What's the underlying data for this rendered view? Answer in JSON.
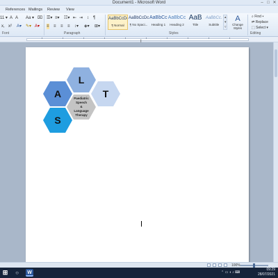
{
  "window": {
    "title": "Document1 - Microsoft Word"
  },
  "menu": {
    "tabs": [
      "References",
      "Mailings",
      "Review",
      "View"
    ]
  },
  "ribbon": {
    "groups": {
      "font": "Font",
      "paragraph": "Paragraph",
      "styles": "Styles",
      "editing": "Editing"
    },
    "styles": [
      {
        "sample": "AaBbCcDc",
        "name": "¶ Normal"
      },
      {
        "sample": "AaBbCcDc",
        "name": "¶ No Spaci..."
      },
      {
        "sample": "AaBbCc",
        "name": "Heading 1"
      },
      {
        "sample": "AaBbCc",
        "name": "Heading 2"
      },
      {
        "sample": "AaB",
        "name": "Title"
      },
      {
        "sample": "AaBbCc.",
        "name": "Subtitle"
      }
    ],
    "change_styles": "Change Styles",
    "editing": {
      "find": "Find",
      "replace": "Replace",
      "select": "Select"
    }
  },
  "document": {
    "hexagons": [
      {
        "letter": "L",
        "color": "#8fb1e0"
      },
      {
        "letter": "A",
        "color": "#5b8fd6"
      },
      {
        "letter": "T",
        "color": "#c6d7f0"
      },
      {
        "letter": "S",
        "color": "#1e9de0"
      }
    ],
    "center_hex": {
      "color": "#c4c4c4",
      "lines": [
        "Paediatric",
        "Speech",
        "&",
        "Language",
        "Therapy"
      ]
    }
  },
  "statusbar": {
    "zoom": "100%"
  },
  "taskbar": {
    "time": "09:29",
    "date": "28/07/2021"
  },
  "colors": {
    "ribbon_bg": "#dde8f5",
    "workspace": "#a9b7c9",
    "taskbar": "#16243a",
    "word_blue": "#2b579a"
  },
  "icons": {
    "search": "search-icon",
    "word": "word-icon",
    "chrome": "chrome-icon",
    "start": "windows-start-icon"
  }
}
